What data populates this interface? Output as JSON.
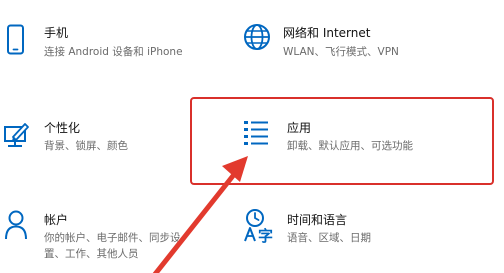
{
  "accent_color": "#0067c0",
  "annotation_color": "#e23a2e",
  "tiles": {
    "phone": {
      "icon": "phone-icon",
      "title": "手机",
      "desc": "连接 Android 设备和 iPhone"
    },
    "network": {
      "icon": "globe-icon",
      "title": "网络和 Internet",
      "desc": "WLAN、飞行模式、VPN"
    },
    "personalization": {
      "icon": "personalization-icon",
      "title": "个性化",
      "desc": "背景、锁屏、颜色"
    },
    "apps": {
      "icon": "apps-list-icon",
      "title": "应用",
      "desc": "卸载、默认应用、可选功能",
      "highlighted": true
    },
    "accounts": {
      "icon": "person-icon",
      "title": "帐户",
      "desc": "你的帐户、电子邮件、同步设",
      "desc2": "置、工作、其他人员"
    },
    "time_language": {
      "icon": "time-language-icon",
      "title": "时间和语言",
      "desc": "语音、区域、日期"
    }
  }
}
